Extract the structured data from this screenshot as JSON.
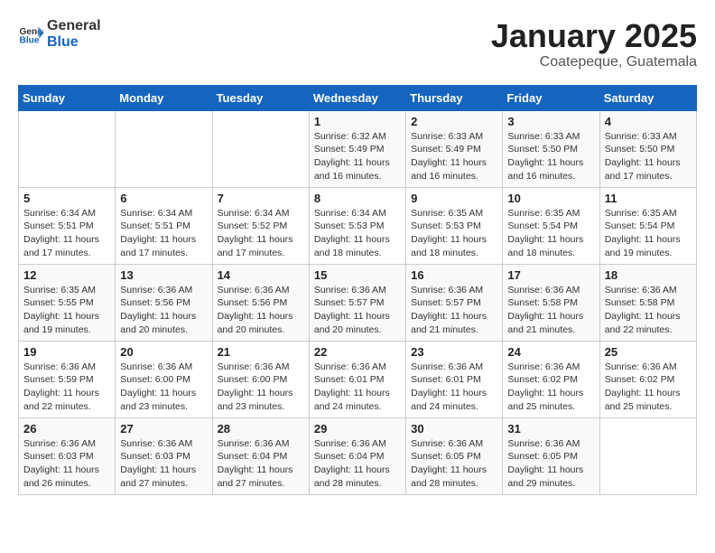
{
  "header": {
    "logo_general": "General",
    "logo_blue": "Blue",
    "title": "January 2025",
    "location": "Coatepeque, Guatemala"
  },
  "weekdays": [
    "Sunday",
    "Monday",
    "Tuesday",
    "Wednesday",
    "Thursday",
    "Friday",
    "Saturday"
  ],
  "weeks": [
    [
      {
        "day": "",
        "info": ""
      },
      {
        "day": "",
        "info": ""
      },
      {
        "day": "",
        "info": ""
      },
      {
        "day": "1",
        "info": "Sunrise: 6:32 AM\nSunset: 5:49 PM\nDaylight: 11 hours and 16 minutes."
      },
      {
        "day": "2",
        "info": "Sunrise: 6:33 AM\nSunset: 5:49 PM\nDaylight: 11 hours and 16 minutes."
      },
      {
        "day": "3",
        "info": "Sunrise: 6:33 AM\nSunset: 5:50 PM\nDaylight: 11 hours and 16 minutes."
      },
      {
        "day": "4",
        "info": "Sunrise: 6:33 AM\nSunset: 5:50 PM\nDaylight: 11 hours and 17 minutes."
      }
    ],
    [
      {
        "day": "5",
        "info": "Sunrise: 6:34 AM\nSunset: 5:51 PM\nDaylight: 11 hours and 17 minutes."
      },
      {
        "day": "6",
        "info": "Sunrise: 6:34 AM\nSunset: 5:51 PM\nDaylight: 11 hours and 17 minutes."
      },
      {
        "day": "7",
        "info": "Sunrise: 6:34 AM\nSunset: 5:52 PM\nDaylight: 11 hours and 17 minutes."
      },
      {
        "day": "8",
        "info": "Sunrise: 6:34 AM\nSunset: 5:53 PM\nDaylight: 11 hours and 18 minutes."
      },
      {
        "day": "9",
        "info": "Sunrise: 6:35 AM\nSunset: 5:53 PM\nDaylight: 11 hours and 18 minutes."
      },
      {
        "day": "10",
        "info": "Sunrise: 6:35 AM\nSunset: 5:54 PM\nDaylight: 11 hours and 18 minutes."
      },
      {
        "day": "11",
        "info": "Sunrise: 6:35 AM\nSunset: 5:54 PM\nDaylight: 11 hours and 19 minutes."
      }
    ],
    [
      {
        "day": "12",
        "info": "Sunrise: 6:35 AM\nSunset: 5:55 PM\nDaylight: 11 hours and 19 minutes."
      },
      {
        "day": "13",
        "info": "Sunrise: 6:36 AM\nSunset: 5:56 PM\nDaylight: 11 hours and 20 minutes."
      },
      {
        "day": "14",
        "info": "Sunrise: 6:36 AM\nSunset: 5:56 PM\nDaylight: 11 hours and 20 minutes."
      },
      {
        "day": "15",
        "info": "Sunrise: 6:36 AM\nSunset: 5:57 PM\nDaylight: 11 hours and 20 minutes."
      },
      {
        "day": "16",
        "info": "Sunrise: 6:36 AM\nSunset: 5:57 PM\nDaylight: 11 hours and 21 minutes."
      },
      {
        "day": "17",
        "info": "Sunrise: 6:36 AM\nSunset: 5:58 PM\nDaylight: 11 hours and 21 minutes."
      },
      {
        "day": "18",
        "info": "Sunrise: 6:36 AM\nSunset: 5:58 PM\nDaylight: 11 hours and 22 minutes."
      }
    ],
    [
      {
        "day": "19",
        "info": "Sunrise: 6:36 AM\nSunset: 5:59 PM\nDaylight: 11 hours and 22 minutes."
      },
      {
        "day": "20",
        "info": "Sunrise: 6:36 AM\nSunset: 6:00 PM\nDaylight: 11 hours and 23 minutes."
      },
      {
        "day": "21",
        "info": "Sunrise: 6:36 AM\nSunset: 6:00 PM\nDaylight: 11 hours and 23 minutes."
      },
      {
        "day": "22",
        "info": "Sunrise: 6:36 AM\nSunset: 6:01 PM\nDaylight: 11 hours and 24 minutes."
      },
      {
        "day": "23",
        "info": "Sunrise: 6:36 AM\nSunset: 6:01 PM\nDaylight: 11 hours and 24 minutes."
      },
      {
        "day": "24",
        "info": "Sunrise: 6:36 AM\nSunset: 6:02 PM\nDaylight: 11 hours and 25 minutes."
      },
      {
        "day": "25",
        "info": "Sunrise: 6:36 AM\nSunset: 6:02 PM\nDaylight: 11 hours and 25 minutes."
      }
    ],
    [
      {
        "day": "26",
        "info": "Sunrise: 6:36 AM\nSunset: 6:03 PM\nDaylight: 11 hours and 26 minutes."
      },
      {
        "day": "27",
        "info": "Sunrise: 6:36 AM\nSunset: 6:03 PM\nDaylight: 11 hours and 27 minutes."
      },
      {
        "day": "28",
        "info": "Sunrise: 6:36 AM\nSunset: 6:04 PM\nDaylight: 11 hours and 27 minutes."
      },
      {
        "day": "29",
        "info": "Sunrise: 6:36 AM\nSunset: 6:04 PM\nDaylight: 11 hours and 28 minutes."
      },
      {
        "day": "30",
        "info": "Sunrise: 6:36 AM\nSunset: 6:05 PM\nDaylight: 11 hours and 28 minutes."
      },
      {
        "day": "31",
        "info": "Sunrise: 6:36 AM\nSunset: 6:05 PM\nDaylight: 11 hours and 29 minutes."
      },
      {
        "day": "",
        "info": ""
      }
    ]
  ]
}
